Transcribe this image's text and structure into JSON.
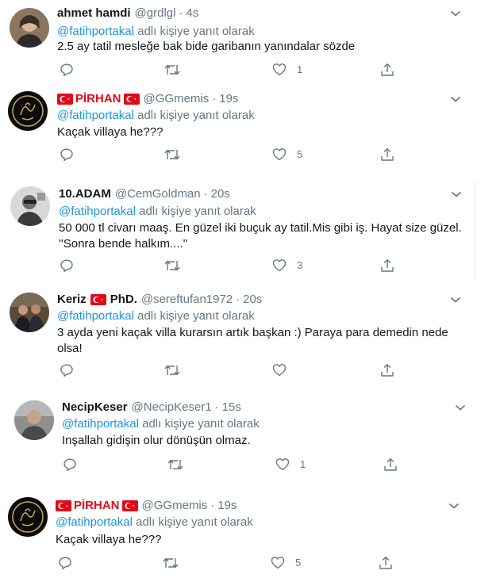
{
  "tweets": [
    {
      "name": "ahmet hamdi",
      "handle": "@grdlgl",
      "time": "4s",
      "reply_to": "@fatihportakal",
      "reply_suffix": "adlı kişiye yanıt olarak",
      "lines": [
        "2.5 ay tatil mesleğe bak bide garibanın yanındalar sözde"
      ],
      "likes": "1",
      "avatar_icon": "person-avatar"
    },
    {
      "name": "PİRHAN",
      "handle": "@GGmemis",
      "time": "19s",
      "reply_to": "@fatihportakal",
      "reply_suffix": "adlı kişiye yanıt olarak",
      "lines": [
        "Kaçak villaya he???"
      ],
      "likes": "5",
      "avatar_icon": "calligraphy-avatar"
    },
    {
      "name": "10.ADAM",
      "handle": "@CemGoldman",
      "time": "20s",
      "reply_to": "@fatihportakal",
      "reply_suffix": "adlı kişiye yanıt olarak",
      "lines": [
        "50 000  tl civarı maaş. En güzel iki buçuk ay tatil.Mis gibi iş.  Hayat size güzel.",
        "''Sonra bende halkım....''"
      ],
      "likes": "3",
      "avatar_icon": "person-avatar"
    },
    {
      "name": "Keriz",
      "name_suffix": "PhD.",
      "handle": "@sereftufan1972",
      "time": "20s",
      "reply_to": "@fatihportakal",
      "reply_suffix": "adlı kişiye yanıt olarak",
      "lines": [
        "3 ayda yeni kaçak villa kurarsın artık başkan :) Paraya para demedin nede",
        "olsa!"
      ],
      "likes": "",
      "avatar_icon": "group-photo-avatar"
    },
    {
      "name": "NecipKeser",
      "handle": "@NecipKeser1",
      "time": "15s",
      "reply_to": "@fatihportakal",
      "reply_suffix": "adlı kişiye yanıt olarak",
      "lines": [
        "Inşallah gidişin olur dönüşün olmaz."
      ],
      "likes": "1",
      "avatar_icon": "person-avatar"
    },
    {
      "name": "PİRHAN",
      "handle": "@GGmemis",
      "time": "19s",
      "reply_to": "@fatihportakal",
      "reply_suffix": "adlı kişiye yanıt olarak",
      "lines": [
        "Kaçak villaya he???"
      ],
      "likes": "5",
      "avatar_icon": "calligraphy-avatar"
    }
  ],
  "colors": {
    "link": "#1b95e0",
    "muted": "#657786",
    "text": "#14171a",
    "flag": "#e30a17"
  },
  "icons": [
    "reply-icon",
    "retweet-icon",
    "like-icon",
    "share-icon",
    "chevron-down-icon",
    "turkish-flag-icon"
  ]
}
